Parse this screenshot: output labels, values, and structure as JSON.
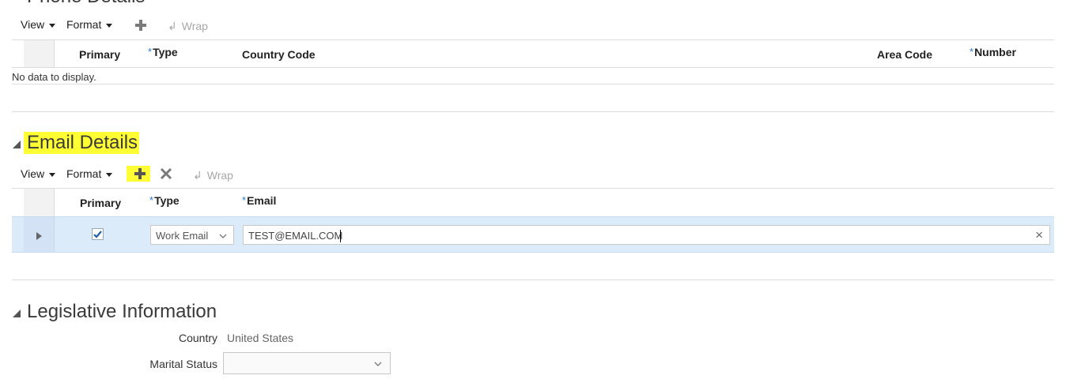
{
  "phone_details": {
    "title": "Phone Details",
    "toolbar": {
      "view": "View",
      "format": "Format",
      "wrap": "Wrap"
    },
    "columns": {
      "primary": "Primary",
      "type": "Type",
      "country_code": "Country Code",
      "area_code": "Area Code",
      "number": "Number"
    },
    "required_marker": "*",
    "empty_message": "No data to display."
  },
  "email_details": {
    "title": "Email Details",
    "toolbar": {
      "view": "View",
      "format": "Format",
      "wrap": "Wrap"
    },
    "columns": {
      "primary": "Primary",
      "type": "Type",
      "email": "Email"
    },
    "required_marker": "*",
    "rows": [
      {
        "primary": true,
        "type": "Work Email",
        "email": "TEST@EMAIL.COM"
      }
    ],
    "clear_glyph": "×"
  },
  "legislative_information": {
    "title": "Legislative Information",
    "country_label": "Country",
    "country_value": "United States",
    "marital_status_label": "Marital Status",
    "marital_status_value": ""
  },
  "colors": {
    "highlight": "#ffff33",
    "selected_row": "#dcebfa",
    "required": "#2b7bd6"
  }
}
